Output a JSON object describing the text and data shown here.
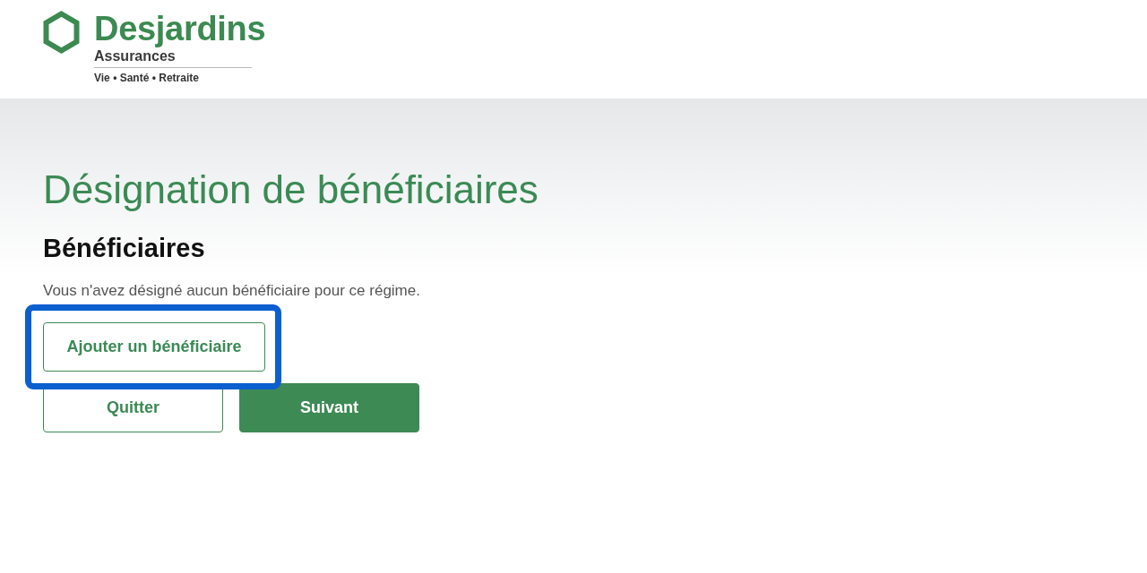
{
  "header": {
    "logo": {
      "brand": "Desjardins",
      "division": "Assurances",
      "tagline": "Vie • Santé • Retraite"
    }
  },
  "page": {
    "title": "Désignation de bénéficiaires",
    "section_heading": "Bénéficiaires",
    "empty_message": "Vous n'avez désigné aucun bénéficiaire pour ce régime.",
    "add_button": {
      "label": "Ajouter un bénéficiaire",
      "highlighted": true
    }
  },
  "actions": [
    {
      "label": "Quitter",
      "kind": "secondary"
    },
    {
      "label": "Suivant",
      "kind": "primary"
    }
  ]
}
